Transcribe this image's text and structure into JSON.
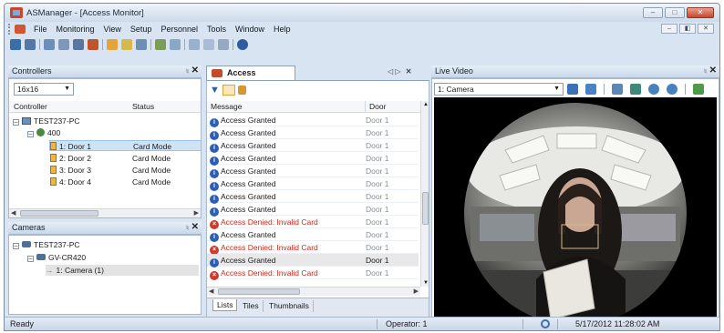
{
  "window": {
    "title": "ASManager - [Access Monitor]"
  },
  "menu": [
    "File",
    "Monitoring",
    "View",
    "Setup",
    "Personnel",
    "Tools",
    "Window",
    "Help"
  ],
  "controllers_panel": {
    "title": "Controllers",
    "grid_select": "16x16",
    "columns": [
      "Controller",
      "Status"
    ],
    "tree": {
      "pc": "TEST237-PC",
      "controller": "400",
      "doors": [
        {
          "name": "1: Door 1",
          "status": "Card Mode"
        },
        {
          "name": "2: Door 2",
          "status": "Card Mode"
        },
        {
          "name": "3: Door 3",
          "status": "Card Mode"
        },
        {
          "name": "4: Door 4",
          "status": "Card Mode"
        }
      ]
    }
  },
  "cameras_panel": {
    "title": "Cameras",
    "pc": "TEST237-PC",
    "device": "GV-CR420",
    "camera": "1: Camera (1)"
  },
  "access_monitor": {
    "tab_label": "Access Monitor",
    "columns": [
      "Message",
      "Door"
    ],
    "rows": [
      {
        "message": "Access Granted",
        "door": "Door 1",
        "type": "info"
      },
      {
        "message": "Access Granted",
        "door": "Door 1",
        "type": "info"
      },
      {
        "message": "Access Granted",
        "door": "Door 1",
        "type": "info"
      },
      {
        "message": "Access Granted",
        "door": "Door 1",
        "type": "info"
      },
      {
        "message": "Access Granted",
        "door": "Door 1",
        "type": "info"
      },
      {
        "message": "Access Granted",
        "door": "Door 1",
        "type": "info"
      },
      {
        "message": "Access Granted",
        "door": "Door 1",
        "type": "info"
      },
      {
        "message": "Access Granted",
        "door": "Door 1",
        "type": "info"
      },
      {
        "message": "Access Denied: Invalid Card",
        "door": "Door 1",
        "type": "error"
      },
      {
        "message": "Access Granted",
        "door": "Door 1",
        "type": "info"
      },
      {
        "message": "Access Denied: Invalid Card",
        "door": "Door 1",
        "type": "error"
      },
      {
        "message": "Access Granted",
        "door": "Door 1",
        "type": "info"
      },
      {
        "message": "Access Denied: Invalid Card",
        "door": "Door 1",
        "type": "error"
      }
    ],
    "bottom_tabs": [
      "Lists",
      "Tiles",
      "Thumbnails"
    ]
  },
  "live_video": {
    "title": "Live Video",
    "camera_select": "1: Camera"
  },
  "status_bar": {
    "state": "Ready",
    "operator": "Operator: 1",
    "datetime": "5/17/2012 11:28:02 AM"
  },
  "colors": {
    "chrome": "#d9e4f2",
    "denied_text": "#d3271b",
    "info_icon": "#2c5fb3",
    "error_icon": "#d03a2c",
    "selection": "#cfe3f7"
  }
}
